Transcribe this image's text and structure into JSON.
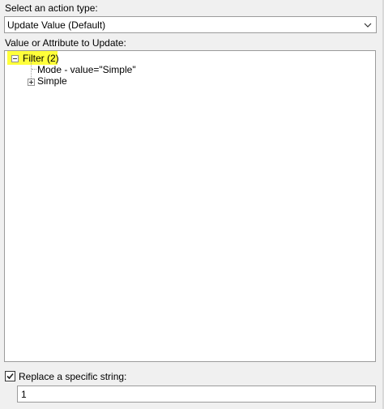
{
  "action_type": {
    "label": "Select an action type:",
    "selected": "Update Value (Default)"
  },
  "target": {
    "label": "Value or Attribute to Update:",
    "tree": {
      "filter_label": "Filter (2)",
      "mode_label": "Mode - value=\"Simple\"",
      "simple_label": "Simple"
    }
  },
  "replace": {
    "checked": true,
    "label": "Replace a specific string:",
    "value": "1"
  },
  "colors": {
    "highlight": "#ffff3a"
  },
  "icons": {
    "expanded": "minus-box-icon",
    "collapsed": "plus-box-icon",
    "dropdown": "chevron-down-icon",
    "check": "checkmark-icon"
  }
}
